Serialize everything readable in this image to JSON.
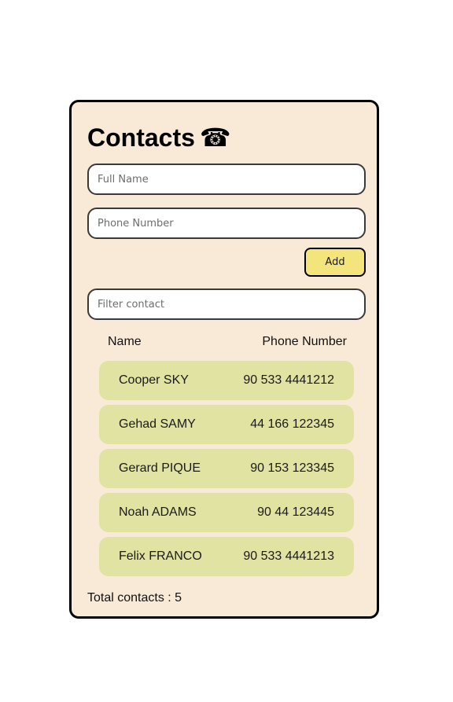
{
  "header": {
    "title": "Contacts",
    "icon_glyph": "☎",
    "icon_name": "telephone-icon"
  },
  "form": {
    "name_placeholder": "Full Name",
    "phone_placeholder": "Phone Number",
    "add_label": "Add"
  },
  "filter": {
    "placeholder": "Filter contact"
  },
  "table": {
    "headers": [
      "Name",
      "Phone Number"
    ],
    "rows": [
      {
        "name": "Cooper SKY",
        "phone": "90 533 4441212"
      },
      {
        "name": "Gehad SAMY",
        "phone": "44 166 122345"
      },
      {
        "name": "Gerard PIQUE",
        "phone": "90 153 123345"
      },
      {
        "name": "Noah ADAMS",
        "phone": "90 44 123445"
      },
      {
        "name": "Felix FRANCO",
        "phone": "90 533 4441213"
      }
    ]
  },
  "footer": {
    "total_label": "Total contacts : 5"
  },
  "colors": {
    "card_bg": "#f9ead8",
    "row_bg": "#e1e3a2",
    "button_bg": "#f4e47c",
    "border": "#000000"
  }
}
